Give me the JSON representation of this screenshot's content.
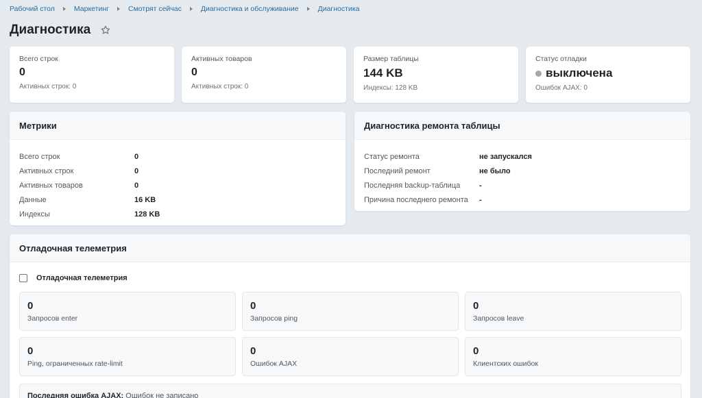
{
  "breadcrumb": [
    "Рабочий стол",
    "Маркетинг",
    "Смотрят сейчас",
    "Диагностика и обслуживание",
    "Диагностика"
  ],
  "page": {
    "title": "Диагностика",
    "star_icon": "star-outline-icon"
  },
  "stats": [
    {
      "label": "Всего строк",
      "value": "0",
      "sub": "Активных строк: 0"
    },
    {
      "label": "Активных товаров",
      "value": "0",
      "sub": "Активных строк: 0"
    },
    {
      "label": "Размер таблицы",
      "value": "144 KB",
      "sub": "Индексы: 128 KB"
    },
    {
      "label": "Статус отладки",
      "value": "выключена",
      "sub": "Ошибок AJAX: 0",
      "status_color": "#a1a7ad"
    }
  ],
  "metrics": {
    "title": "Метрики",
    "rows": [
      {
        "key": "Всего строк",
        "value": "0"
      },
      {
        "key": "Активных строк",
        "value": "0"
      },
      {
        "key": "Активных товаров",
        "value": "0"
      },
      {
        "key": "Данные",
        "value": "16 KB"
      },
      {
        "key": "Индексы",
        "value": "128 KB"
      }
    ]
  },
  "repair": {
    "title": "Диагностика ремонта таблицы",
    "rows": [
      {
        "key": "Статус ремонта",
        "value": "не запускался"
      },
      {
        "key": "Последний ремонт",
        "value": "не было"
      },
      {
        "key": "Последняя backup-таблица",
        "value": "-"
      },
      {
        "key": "Причина последнего ремонта",
        "value": "-"
      }
    ]
  },
  "telemetry": {
    "title": "Отладочная телеметрия",
    "checkbox_label": "Отладочная телеметрия",
    "checked": false,
    "tiles": [
      {
        "value": "0",
        "label": "Запросов enter"
      },
      {
        "value": "0",
        "label": "Запросов ping"
      },
      {
        "value": "0",
        "label": "Запросов leave"
      },
      {
        "value": "0",
        "label": "Ping, ограниченных rate-limit"
      },
      {
        "value": "0",
        "label": "Ошибок AJAX"
      },
      {
        "value": "0",
        "label": "Клиентских ошибок"
      }
    ],
    "last_error_label": "Последняя ошибка AJAX:",
    "last_error_value": "Ошибок не записано"
  },
  "colors": {
    "background": "#e5eaee",
    "link": "#2d6b99",
    "card": "#ffffff",
    "panel_header": "#f6f8fa"
  }
}
